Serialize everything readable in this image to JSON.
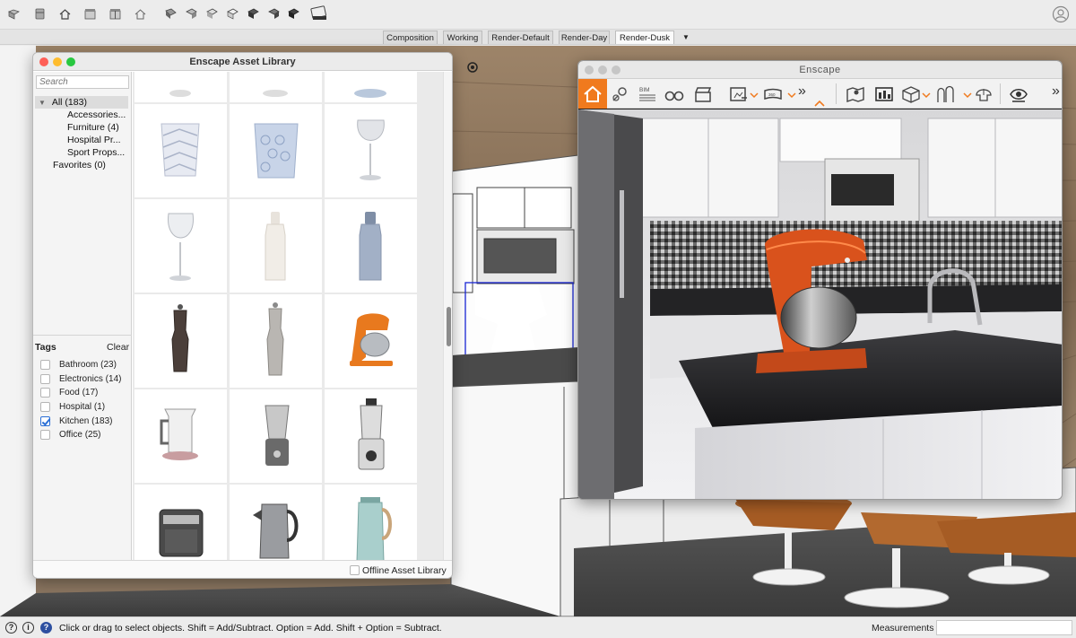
{
  "toolbar": {
    "icons": [
      "select-icon",
      "eraser-icon",
      "home-view-icon",
      "front-view-icon",
      "right-view-icon",
      "back-view-icon",
      "materials-icon",
      "components-icon",
      "styles-icon",
      "layers-icon",
      "outliner-icon",
      "scenes-icon",
      "shadows-icon",
      "extension-icon"
    ],
    "user_icon": "account-icon"
  },
  "scene_tabs": {
    "tabs": [
      {
        "label": "Composition",
        "active": false
      },
      {
        "label": "Working",
        "active": false
      },
      {
        "label": "Render-Default",
        "active": false
      },
      {
        "label": "Render-Day",
        "active": false
      },
      {
        "label": "Render-Dusk",
        "active": true
      }
    ],
    "more_label": "▼"
  },
  "asset_library": {
    "title": "Enscape Asset Library",
    "search_placeholder": "Search",
    "tree": {
      "all_label": "All (183)",
      "children": [
        "Accessories...",
        "Furniture (4)",
        "Hospital Pr...",
        "Sport Props..."
      ],
      "favorites_label": "Favorites (0)"
    },
    "tags_label": "Tags",
    "clear_label": "Clear",
    "tags": [
      {
        "label": "Bathroom (23)",
        "checked": false
      },
      {
        "label": "Electronics (14)",
        "checked": false
      },
      {
        "label": "Food (17)",
        "checked": false
      },
      {
        "label": "Hospital (1)",
        "checked": false
      },
      {
        "label": "Kitchen (183)",
        "checked": true
      },
      {
        "label": "Office (25)",
        "checked": false
      }
    ],
    "assets": [
      "glass",
      "glass",
      "bowl",
      "patterned-tumbler",
      "crystal-tumbler",
      "wine-glass",
      "wine-glass",
      "bottle-white",
      "bottle-blue",
      "pepper-mill-dark",
      "pepper-mill-light",
      "stand-mixer-orange",
      "electric-kettle",
      "blender",
      "blender",
      "air-fryer",
      "kettle-steel",
      "kettle-teal"
    ],
    "footer": {
      "offline_label": "Offline Asset Library",
      "offline_checked": false
    }
  },
  "enscape": {
    "title": "Enscape",
    "toolbar_icons": [
      "home-icon",
      "location-icon",
      "bim-icon",
      "binoculars-icon",
      "clapperboard-icon",
      "screenshot-export-icon",
      "panorama-export-icon",
      "more-icon",
      "map-icon",
      "asset-library-icon",
      "cube-icon",
      "silhouettes-icon",
      "atmosphere-icon",
      "visual-settings-icon",
      "overflow-icon"
    ],
    "bim_label": "BIM",
    "more_label": "»"
  },
  "status_bar": {
    "text": "Click or drag to select objects. Shift = Add/Subtract. Option = Add. Shift + Option = Subtract.",
    "measurements_label": "Measurements",
    "measurements_value": ""
  },
  "colors": {
    "enscape_accent": "#f07a1e",
    "selection_blue": "#1a27d6",
    "mixer_orange": "#e8551b"
  }
}
